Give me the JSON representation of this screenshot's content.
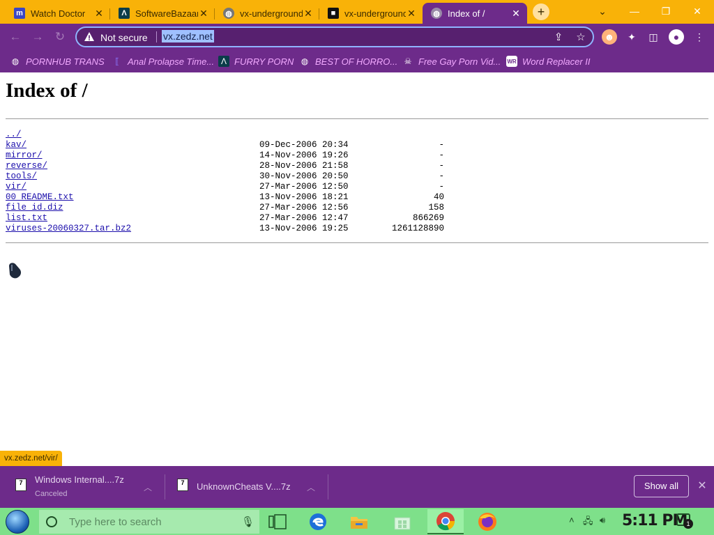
{
  "tabs": [
    {
      "title": "Watch Doctor",
      "favicon": "m-icon",
      "favicon_glyph": "m",
      "favicon_color": "#3b46c4"
    },
    {
      "title": "SoftwareBazaar",
      "favicon": "lambda-icon",
      "favicon_glyph": "Λ",
      "favicon_color": "#0b3d4a"
    },
    {
      "title": "vx-underground",
      "favicon": "globe-icon",
      "favicon_glyph": "◍",
      "favicon_color": "#777777"
    },
    {
      "title": "vx-underground",
      "favicon": "vx-icon",
      "favicon_glyph": "■",
      "favicon_color": "#111111"
    },
    {
      "title": "Index of /",
      "favicon": "globe-icon",
      "favicon_glyph": "◍",
      "favicon_color": "#9a8aa8"
    }
  ],
  "omnibox": {
    "security_label": "Not secure",
    "url": "vx.zedz.net"
  },
  "bookmarks": [
    {
      "label": "PORNHUB TRANS",
      "icon": "globe-icon",
      "glyph": "◍"
    },
    {
      "label": "Anal Prolapse Time...",
      "icon": "bracket-icon",
      "glyph": "⟦"
    },
    {
      "label": "FURRY PORN",
      "icon": "lambda-icon",
      "glyph": "Λ"
    },
    {
      "label": "BEST OF HORRO...",
      "icon": "globe-icon",
      "glyph": "◍"
    },
    {
      "label": "Free Gay Porn Vid...",
      "icon": "skull-icon",
      "glyph": "☠"
    },
    {
      "label": "Word Replacer II",
      "icon": "wr-icon",
      "glyph": "WR"
    }
  ],
  "page": {
    "heading": "Index of /",
    "parent_link": "../",
    "entries": [
      {
        "name": "kav/",
        "date": "09-Dec-2006 20:34",
        "size": "-"
      },
      {
        "name": "mirror/",
        "date": "14-Nov-2006 19:26",
        "size": "-"
      },
      {
        "name": "reverse/",
        "date": "28-Nov-2006 21:58",
        "size": "-"
      },
      {
        "name": "tools/",
        "date": "30-Nov-2006 20:50",
        "size": "-"
      },
      {
        "name": "vir/",
        "date": "27-Mar-2006 12:50",
        "size": "-"
      },
      {
        "name": "00_README.txt",
        "date": "13-Nov-2006 18:21",
        "size": "40"
      },
      {
        "name": "file_id.diz",
        "date": "27-Mar-2006 12:56",
        "size": "158"
      },
      {
        "name": "list.txt",
        "date": "27-Mar-2006 12:47",
        "size": "866269"
      },
      {
        "name": "viruses-20060327.tar.bz2",
        "date": "13-Nov-2006 19:25",
        "size": "1261128890"
      }
    ]
  },
  "status_bar": {
    "text": "vx.zedz.net/vir/"
  },
  "downloads": {
    "items": [
      {
        "name": "Windows Internal....7z",
        "status": "Canceled",
        "icon": "7z-file-icon"
      },
      {
        "name": "UnknownCheats V....7z",
        "status": "",
        "icon": "7z-file-icon"
      }
    ],
    "show_all_label": "Show all"
  },
  "taskbar": {
    "search_placeholder": "Type here to search",
    "clock": "5:11 PM",
    "notification_count": "1"
  },
  "colors": {
    "tabstrip": "#f9b208",
    "theme_purple": "#6d2b8a",
    "link": "#1a0dab",
    "taskbar": "#7ee08a"
  }
}
